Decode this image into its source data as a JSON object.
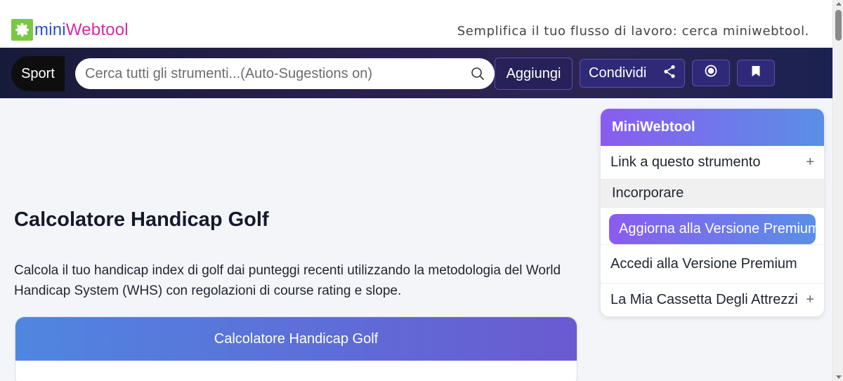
{
  "header": {
    "logo_mini": "mini",
    "logo_web": "Webtool",
    "tagline": "Semplifica il tuo flusso di lavoro: cerca miniwebtool."
  },
  "nav": {
    "category": "Sport",
    "search_placeholder": "Cerca tutti gli strumenti...(Auto-Sugestions on)",
    "add_label": "Aggiungi",
    "share_label": "Condividi"
  },
  "main": {
    "title": "Calcolatore Handicap Golf",
    "description": "Calcola il tuo handicap index di golf dai punteggi recenti utilizzando la metodologia del World Handicap System (WHS) con regolazioni di course rating e slope.",
    "card_title": "Calcolatore Handicap Golf"
  },
  "side_panel": {
    "title": "MiniWebtool",
    "link_label": "Link a questo strumento",
    "embed_label": "Incorporare",
    "upgrade_label": "Aggiorna alla Versione Premium",
    "login_label": "Accedi alla Versione Premium",
    "toolbox_label": "La Mia Cassetta Degli Attrezzi",
    "plus": "+"
  },
  "colors": {
    "accent_purple": "#8a5cf0",
    "accent_blue": "#5a8fe6",
    "logo_green": "#7ac943",
    "logo_blue": "#2b4fd6",
    "logo_magenta": "#d62aa6"
  }
}
